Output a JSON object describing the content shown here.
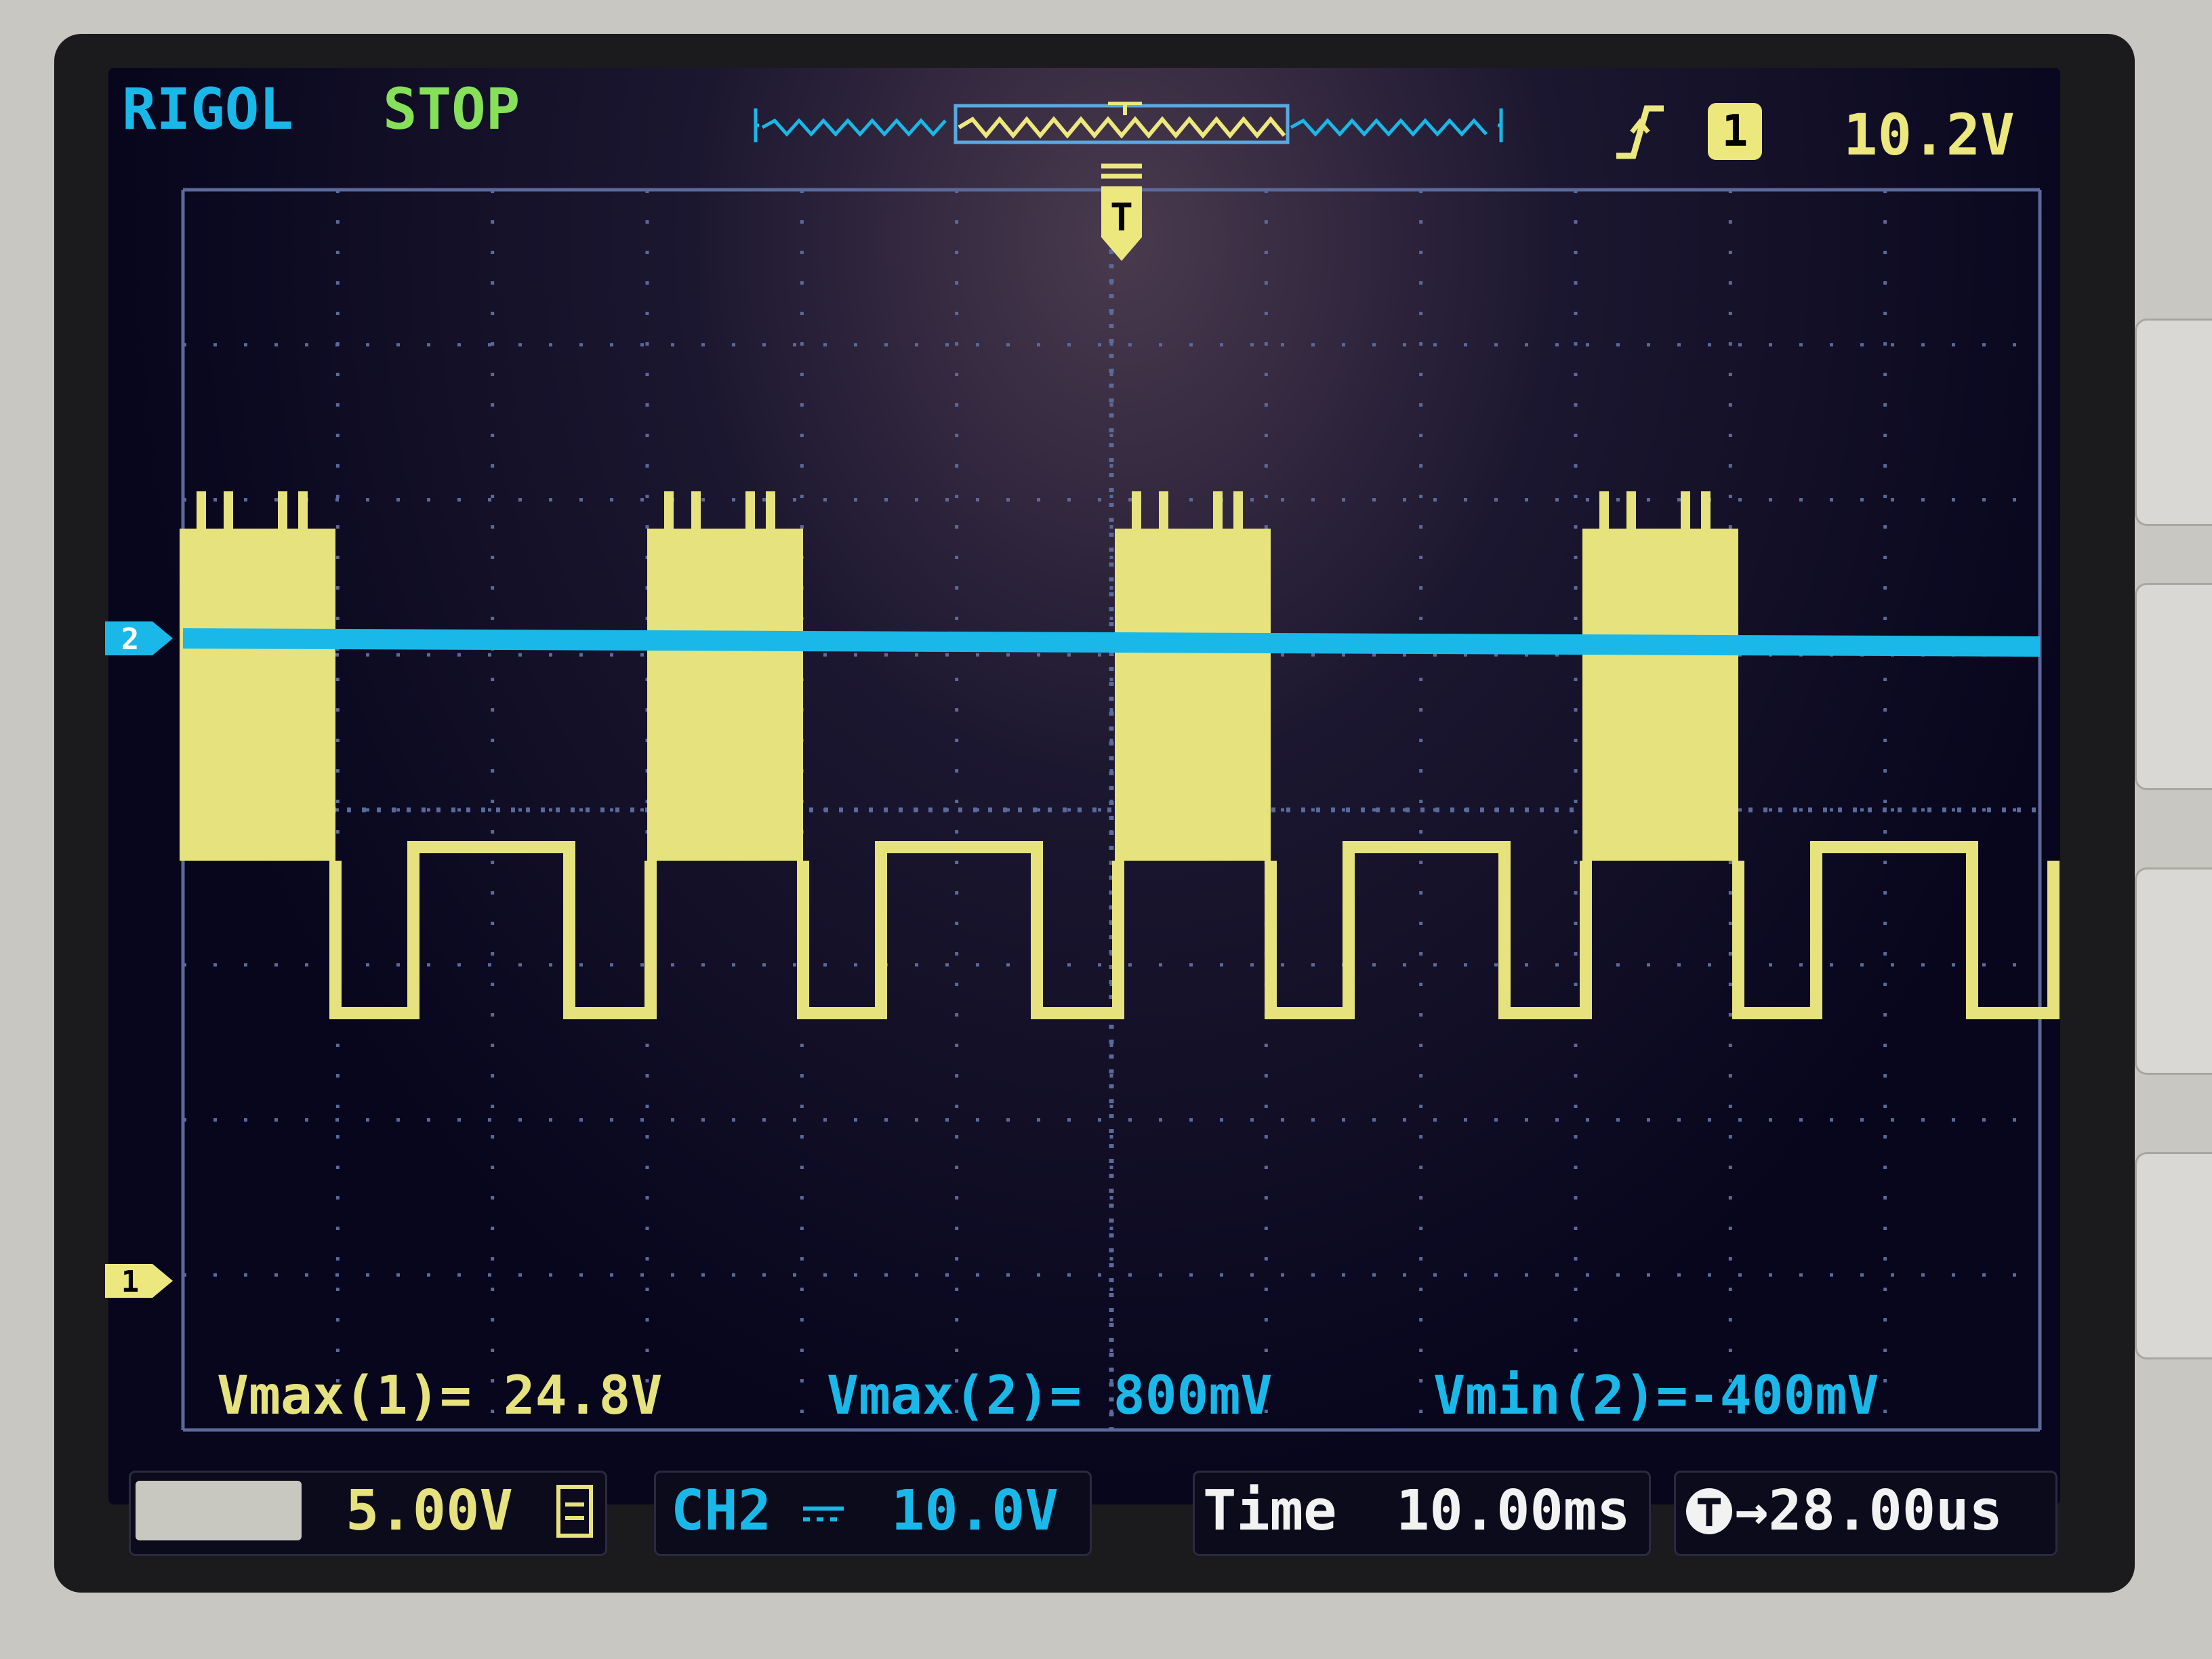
{
  "header": {
    "brand": "RIGOL",
    "run_state": "STOP",
    "trigger_source": "1",
    "trigger_level": "10.2V"
  },
  "markers": {
    "ch2": "2",
    "ch1": "1",
    "trigger": "T"
  },
  "measurements": [
    "Vmax(1)= 24.8V",
    "Vmax(2)= 800mV",
    "Vmin(2)=-400mV"
  ],
  "status_bar": {
    "ch1_scale": "5.00V",
    "ch2_label": "CH2",
    "ch2_scale": "10.0V",
    "time_label": "Time",
    "time_scale": "10.00ms",
    "trigger_offset": "28.00us"
  },
  "colors": {
    "ch1": "#e6e27e",
    "ch2": "#1ab8e8",
    "grid": "#5a6a9a",
    "run_state": "#86e05a"
  },
  "icons": {
    "trigger_edge": "rising-edge-icon",
    "ch1_coupling": "dc-coupling-icon",
    "ch2_coupling": "dc-coupling-icon",
    "trigger_position": "trigger-position-icon"
  }
}
